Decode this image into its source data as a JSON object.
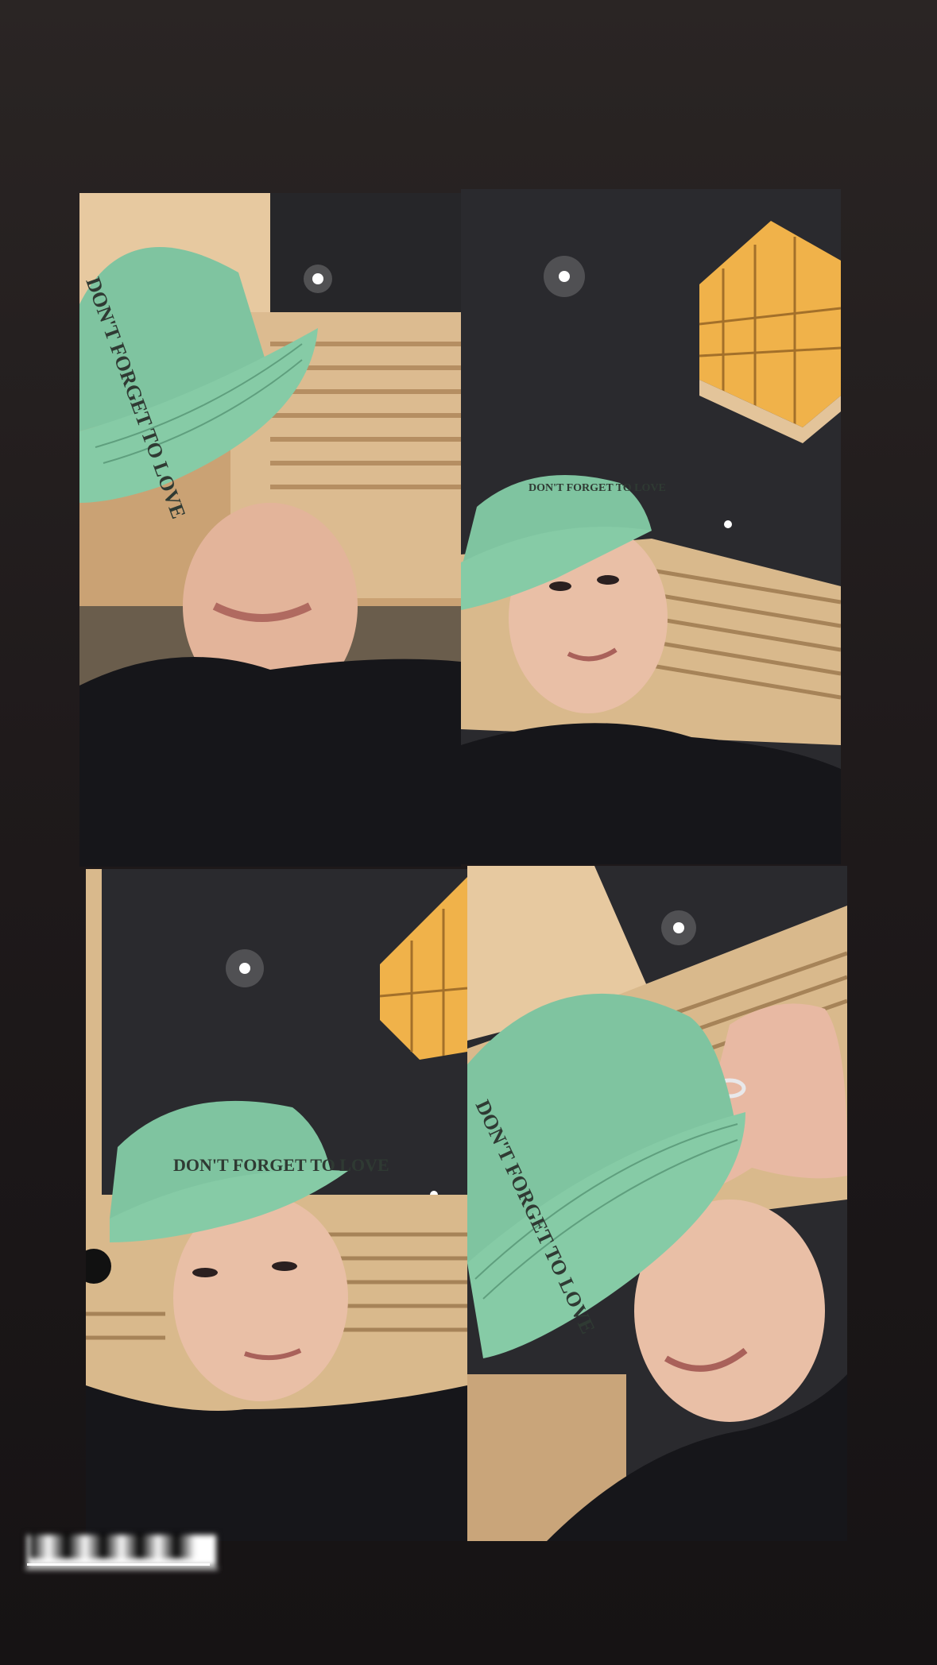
{
  "story": {
    "background_color": "#1f1a1b",
    "collage_layout": "2x2 grid",
    "mention_sticker": {
      "text": "",
      "obscured": true
    }
  },
  "panels": [
    {
      "id": "top-left",
      "cap_print": [
        "DON'T",
        "FORGET",
        "TO LOVE"
      ]
    },
    {
      "id": "top-right",
      "cap_print": [
        "DON'T",
        "FORGET",
        "TO LOVE"
      ]
    },
    {
      "id": "bottom-left",
      "cap_print": [
        "DON'T",
        "FORGET",
        "TO LOVE"
      ]
    },
    {
      "id": "bottom-right",
      "cap_print": [
        "DON'T",
        "FORGET",
        "TO LOVE"
      ]
    }
  ],
  "colors": {
    "cap_green": "#7fc4a0",
    "sweater_black": "#16161a",
    "wood_panel": "#d9b98c",
    "ceiling_dark": "#2a2a2e",
    "lamp_amber": "#f0b24a"
  }
}
